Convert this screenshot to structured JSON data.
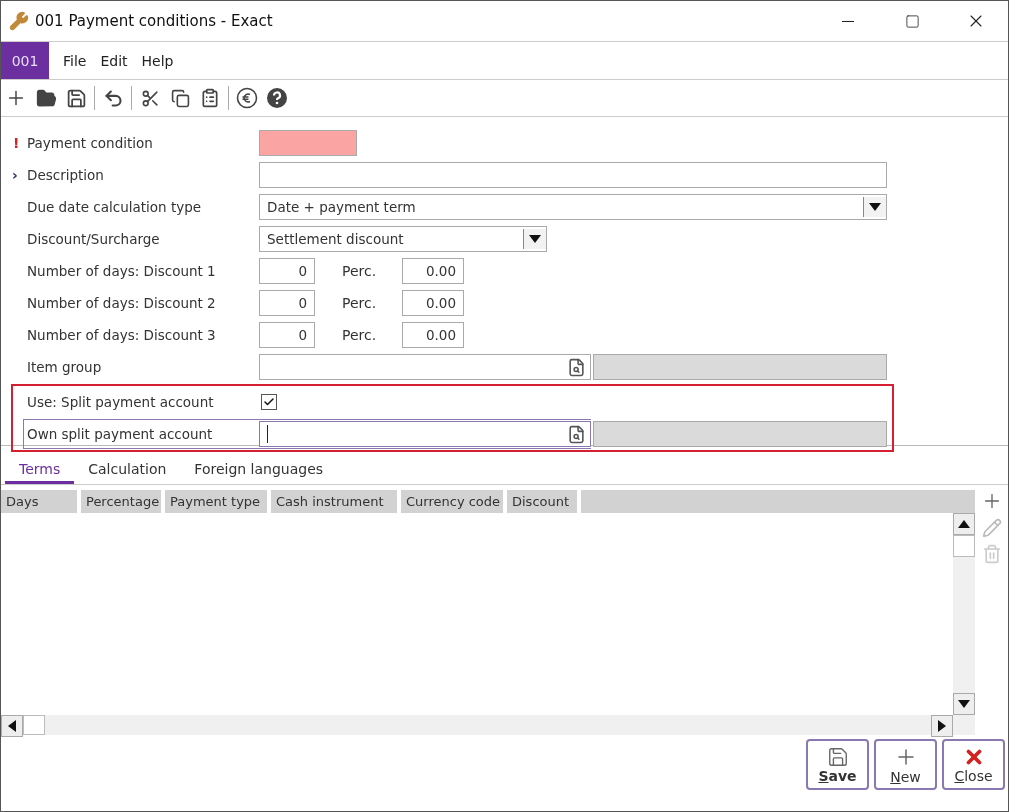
{
  "window": {
    "title": "001 Payment conditions - Exact"
  },
  "menu": {
    "company": "001",
    "items": [
      "File",
      "Edit",
      "Help"
    ]
  },
  "form": [
    {
      "kind": "text",
      "label": "Payment condition",
      "marker": "!",
      "required": true,
      "wide": false,
      "invalid": true,
      "highlighted": false
    },
    {
      "kind": "text",
      "label": "Description",
      "marker": "›",
      "required": false,
      "wide": true,
      "invalid": false,
      "highlighted": false
    },
    {
      "kind": "select",
      "label": "Due date calculation type",
      "wide": true,
      "value": "Date + payment term",
      "highlighted": false
    },
    {
      "kind": "select",
      "label": "Discount/Surcharge",
      "wide": false,
      "value": "Settlement discount",
      "highlighted": false
    },
    {
      "kind": "pair",
      "label": "Number of days: Discount 1",
      "value": "0",
      "second_label": "Perc.",
      "second_value": "0.00",
      "highlighted": false
    },
    {
      "kind": "pair",
      "label": "Number of days: Discount 2",
      "value": "0",
      "second_label": "Perc.",
      "second_value": "0.00",
      "highlighted": false
    },
    {
      "kind": "pair",
      "label": "Number of days: Discount 3",
      "value": "0",
      "second_label": "Perc.",
      "second_value": "0.00",
      "highlighted": false
    },
    {
      "kind": "lookup",
      "label": "Item group",
      "focused": false,
      "highlighted": false
    },
    {
      "kind": "checkbox",
      "label": "Use: Split payment account",
      "checked": true,
      "highlighted": true
    },
    {
      "kind": "lookup",
      "label": "Own split payment account",
      "focused": true,
      "highlighted": true
    }
  ],
  "tabs": [
    {
      "label": "Terms",
      "selected": true
    },
    {
      "label": "Calculation",
      "selected": false
    },
    {
      "label": "Foreign languages",
      "selected": false
    }
  ],
  "table": {
    "columns": [
      "Days",
      "Percentage",
      "Payment type",
      "Cash instrument",
      "Currency code",
      "Discount"
    ]
  },
  "buttons": [
    {
      "kind": "save",
      "label": "Save",
      "default": true
    },
    {
      "kind": "new",
      "label": "New",
      "default": false
    },
    {
      "kind": "close",
      "label": "Close",
      "default": false
    }
  ]
}
